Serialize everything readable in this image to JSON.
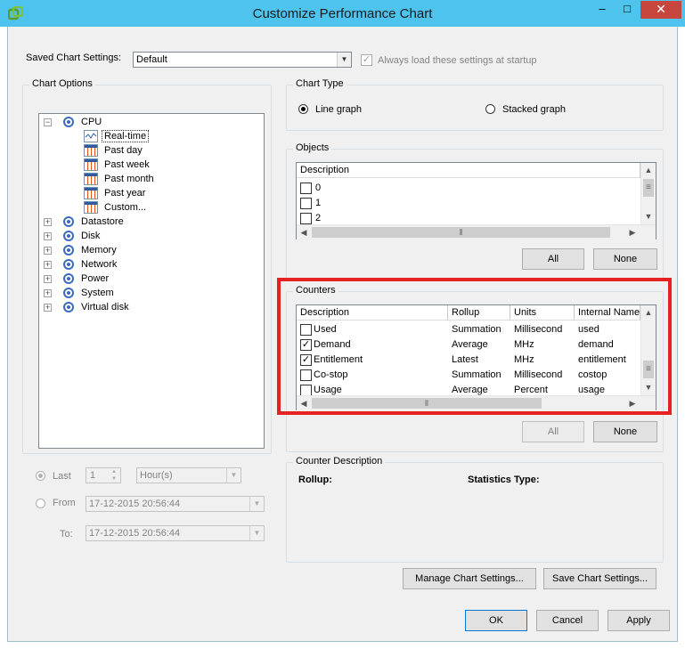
{
  "window": {
    "title": "Customize Performance Chart",
    "min": "–",
    "max": "□",
    "close": "✕"
  },
  "saved": {
    "label": "Saved Chart Settings:",
    "value": "Default",
    "always_label": "Always load these settings at startup",
    "always_checked": true
  },
  "chart_options": {
    "title": "Chart Options",
    "tree": [
      {
        "label": "CPU",
        "expanded": true,
        "children": [
          "Real-time",
          "Past day",
          "Past week",
          "Past month",
          "Past year",
          "Custom..."
        ]
      },
      {
        "label": "Datastore"
      },
      {
        "label": "Disk"
      },
      {
        "label": "Memory"
      },
      {
        "label": "Network"
      },
      {
        "label": "Power"
      },
      {
        "label": "System"
      },
      {
        "label": "Virtual disk"
      }
    ],
    "selected": "Real-time"
  },
  "timerange": {
    "last_label": "Last",
    "last_value": "1",
    "unit": "Hour(s)",
    "from_label": "From",
    "from_value": "17-12-2015 20:56:44",
    "to_label": "To:",
    "to_value": "17-12-2015 20:56:44"
  },
  "chart_type": {
    "title": "Chart Type",
    "line": "Line graph",
    "stacked": "Stacked graph",
    "selected": "line"
  },
  "objects": {
    "title": "Objects",
    "header": "Description",
    "rows": [
      {
        "label": "0",
        "checked": false
      },
      {
        "label": "1",
        "checked": false
      },
      {
        "label": "2",
        "checked": false
      }
    ],
    "all": "All",
    "none": "None"
  },
  "counters": {
    "title": "Counters",
    "columns": [
      "Description",
      "Rollup",
      "Units",
      "Internal Name"
    ],
    "rows": [
      {
        "desc": "Used",
        "rollup": "Summation",
        "units": "Millisecond",
        "internal": "used",
        "checked": false
      },
      {
        "desc": "Demand",
        "rollup": "Average",
        "units": "MHz",
        "internal": "demand",
        "checked": true
      },
      {
        "desc": "Entitlement",
        "rollup": "Latest",
        "units": "MHz",
        "internal": "entitlement",
        "checked": true
      },
      {
        "desc": "Co-stop",
        "rollup": "Summation",
        "units": "Millisecond",
        "internal": "costop",
        "checked": false
      },
      {
        "desc": "Usage",
        "rollup": "Average",
        "units": "Percent",
        "internal": "usage",
        "checked": false
      }
    ],
    "all": "All",
    "none": "None"
  },
  "counter_desc": {
    "title": "Counter Description",
    "rollup": "Rollup:",
    "stats": "Statistics Type:"
  },
  "buttons": {
    "manage": "Manage Chart Settings...",
    "save": "Save Chart Settings...",
    "ok": "OK",
    "cancel": "Cancel",
    "apply": "Apply"
  },
  "icons": {
    "scroll_up": "▲",
    "scroll_down": "▼",
    "scroll_left": "◀",
    "scroll_right": "▶",
    "grip": "≡",
    "hgrip": "⦀",
    "dropdown": "▼",
    "check": "✓",
    "spin_up": "▲",
    "spin_down": "▼"
  },
  "colors": {
    "titlebar": "#4dc3ee",
    "highlight": "#e52121",
    "close": "#c7473f"
  }
}
